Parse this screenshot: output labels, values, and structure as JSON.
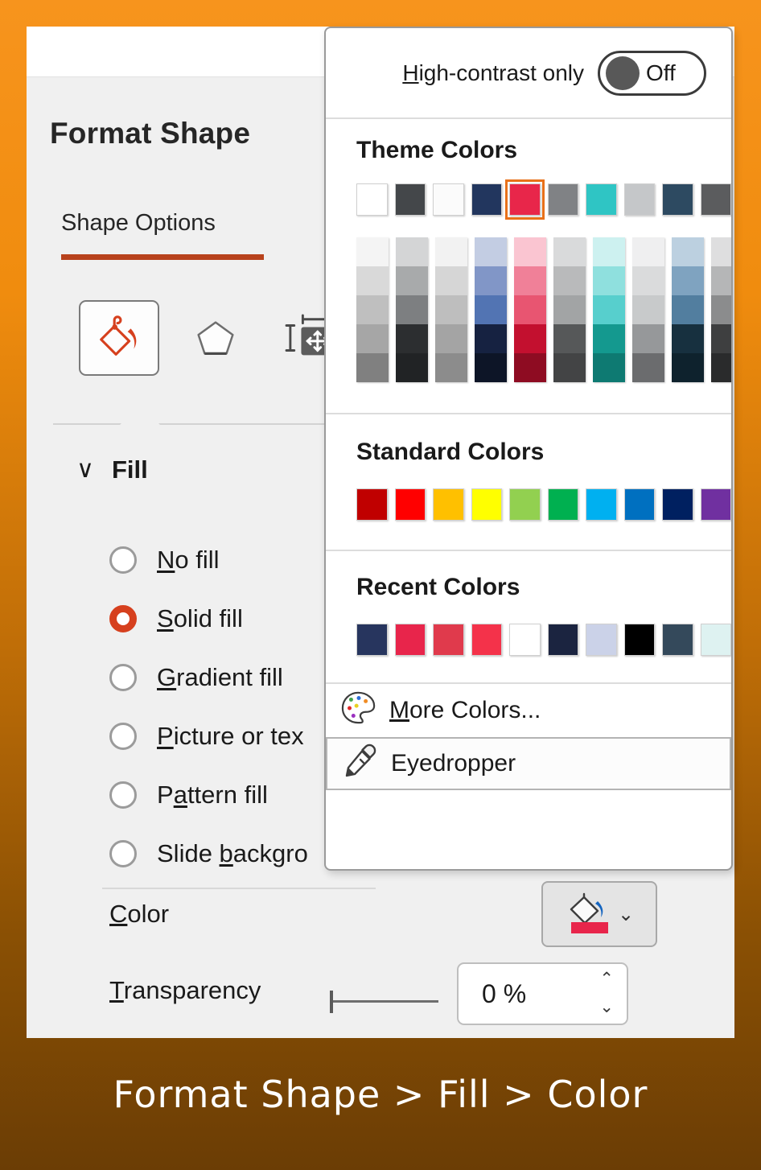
{
  "theme": {
    "border_top": "#F7941D",
    "border_bottom": "#6B3D05",
    "panel_bg": "#F0F0F0",
    "accent": "#B8421C",
    "selected_ring": "#E8711A",
    "radio_on": "#D6401E"
  },
  "panel": {
    "title": "Format Shape",
    "tab": "Shape Options",
    "icons": [
      {
        "name": "fill-and-line-icon",
        "selected": true
      },
      {
        "name": "effects-icon",
        "selected": false
      },
      {
        "name": "size-and-properties-icon",
        "selected": false
      }
    ],
    "section": {
      "label": "Fill",
      "chevron": "∨",
      "options": [
        {
          "label": "No fill",
          "accel": "N",
          "selected": false
        },
        {
          "label": "Solid fill",
          "accel": "S",
          "selected": true
        },
        {
          "label": "Gradient fill",
          "accel": "G",
          "selected": false
        },
        {
          "label": "Picture or tex",
          "accel": "P",
          "selected": false
        },
        {
          "label": "Pattern fill",
          "accel": "a",
          "selected": false
        },
        {
          "label": "Slide backgro",
          "accel": "b",
          "selected": false
        }
      ]
    },
    "color": {
      "label": "Color",
      "accel": "C",
      "swatch_color": "#E8254B",
      "chevron": "⌄"
    },
    "transparency": {
      "label": "Transparency",
      "accel": "T",
      "value": "0 %",
      "up_arrow": "⌃",
      "down_arrow": "⌄"
    }
  },
  "dropdown": {
    "high_contrast": {
      "label": "High-contrast only",
      "accel": "H",
      "state": "Off"
    },
    "theme_colors": {
      "title": "Theme Colors",
      "base": [
        "#FFFFFF",
        "#44474A",
        "#FBFBFB",
        "#22365E",
        "#E8264A",
        "#808285",
        "#2FC5C4",
        "#C5C7C9",
        "#2D4A61",
        "#5B5C5E"
      ],
      "selected_index": 4,
      "variants": [
        [
          "#F4F4F4",
          "#D9D9D9",
          "#BFBFBF",
          "#A6A6A6",
          "#808080"
        ],
        [
          "#D4D5D6",
          "#A8AAAB",
          "#7D7F81",
          "#2C2E30",
          "#212325"
        ],
        [
          "#F2F2F2",
          "#D6D6D6",
          "#BEBEBE",
          "#A4A4A4",
          "#8C8C8C"
        ],
        [
          "#C3CDE3",
          "#8196C7",
          "#5274B3",
          "#162241",
          "#0D1527"
        ],
        [
          "#FAC5D1",
          "#F08098",
          "#E85571",
          "#C3102F",
          "#8E0C22"
        ],
        [
          "#D9DADB",
          "#B9BABB",
          "#A2A4A5",
          "#565859",
          "#434445"
        ],
        [
          "#CDF1F0",
          "#8FE0DE",
          "#57CFCD",
          "#14998F",
          "#0E7A72"
        ],
        [
          "#EFEFF0",
          "#DADBDC",
          "#C8CACB",
          "#96989A",
          "#6B6C6E"
        ],
        [
          "#BCD0E0",
          "#7FA3C0",
          "#527E9F",
          "#17303F",
          "#0E222D"
        ],
        [
          "#DEDEDF",
          "#B5B6B7",
          "#8B8C8D",
          "#3E3F40",
          "#2A2B2C"
        ]
      ]
    },
    "standard_colors": {
      "title": "Standard Colors",
      "colors": [
        "#C00000",
        "#FF0000",
        "#FFC000",
        "#FFFF00",
        "#92D050",
        "#00B050",
        "#00B0F0",
        "#0070C0",
        "#002060",
        "#7030A0"
      ]
    },
    "recent_colors": {
      "title": "Recent Colors",
      "colors": [
        "#27355E",
        "#E8254B",
        "#E03A4C",
        "#F4324A",
        "#FFFFFF",
        "#1B2440",
        "#CBD2E8",
        "#000000",
        "#34495B",
        "#DEF2F1"
      ]
    },
    "menu": [
      {
        "label": "More Colors...",
        "accel": "M",
        "icon": "palette-icon",
        "highlighted": false
      },
      {
        "label": "Eyedropper",
        "accel": "",
        "icon": "eyedropper-icon",
        "highlighted": true
      }
    ]
  },
  "caption": "Format Shape > Fill > Color"
}
